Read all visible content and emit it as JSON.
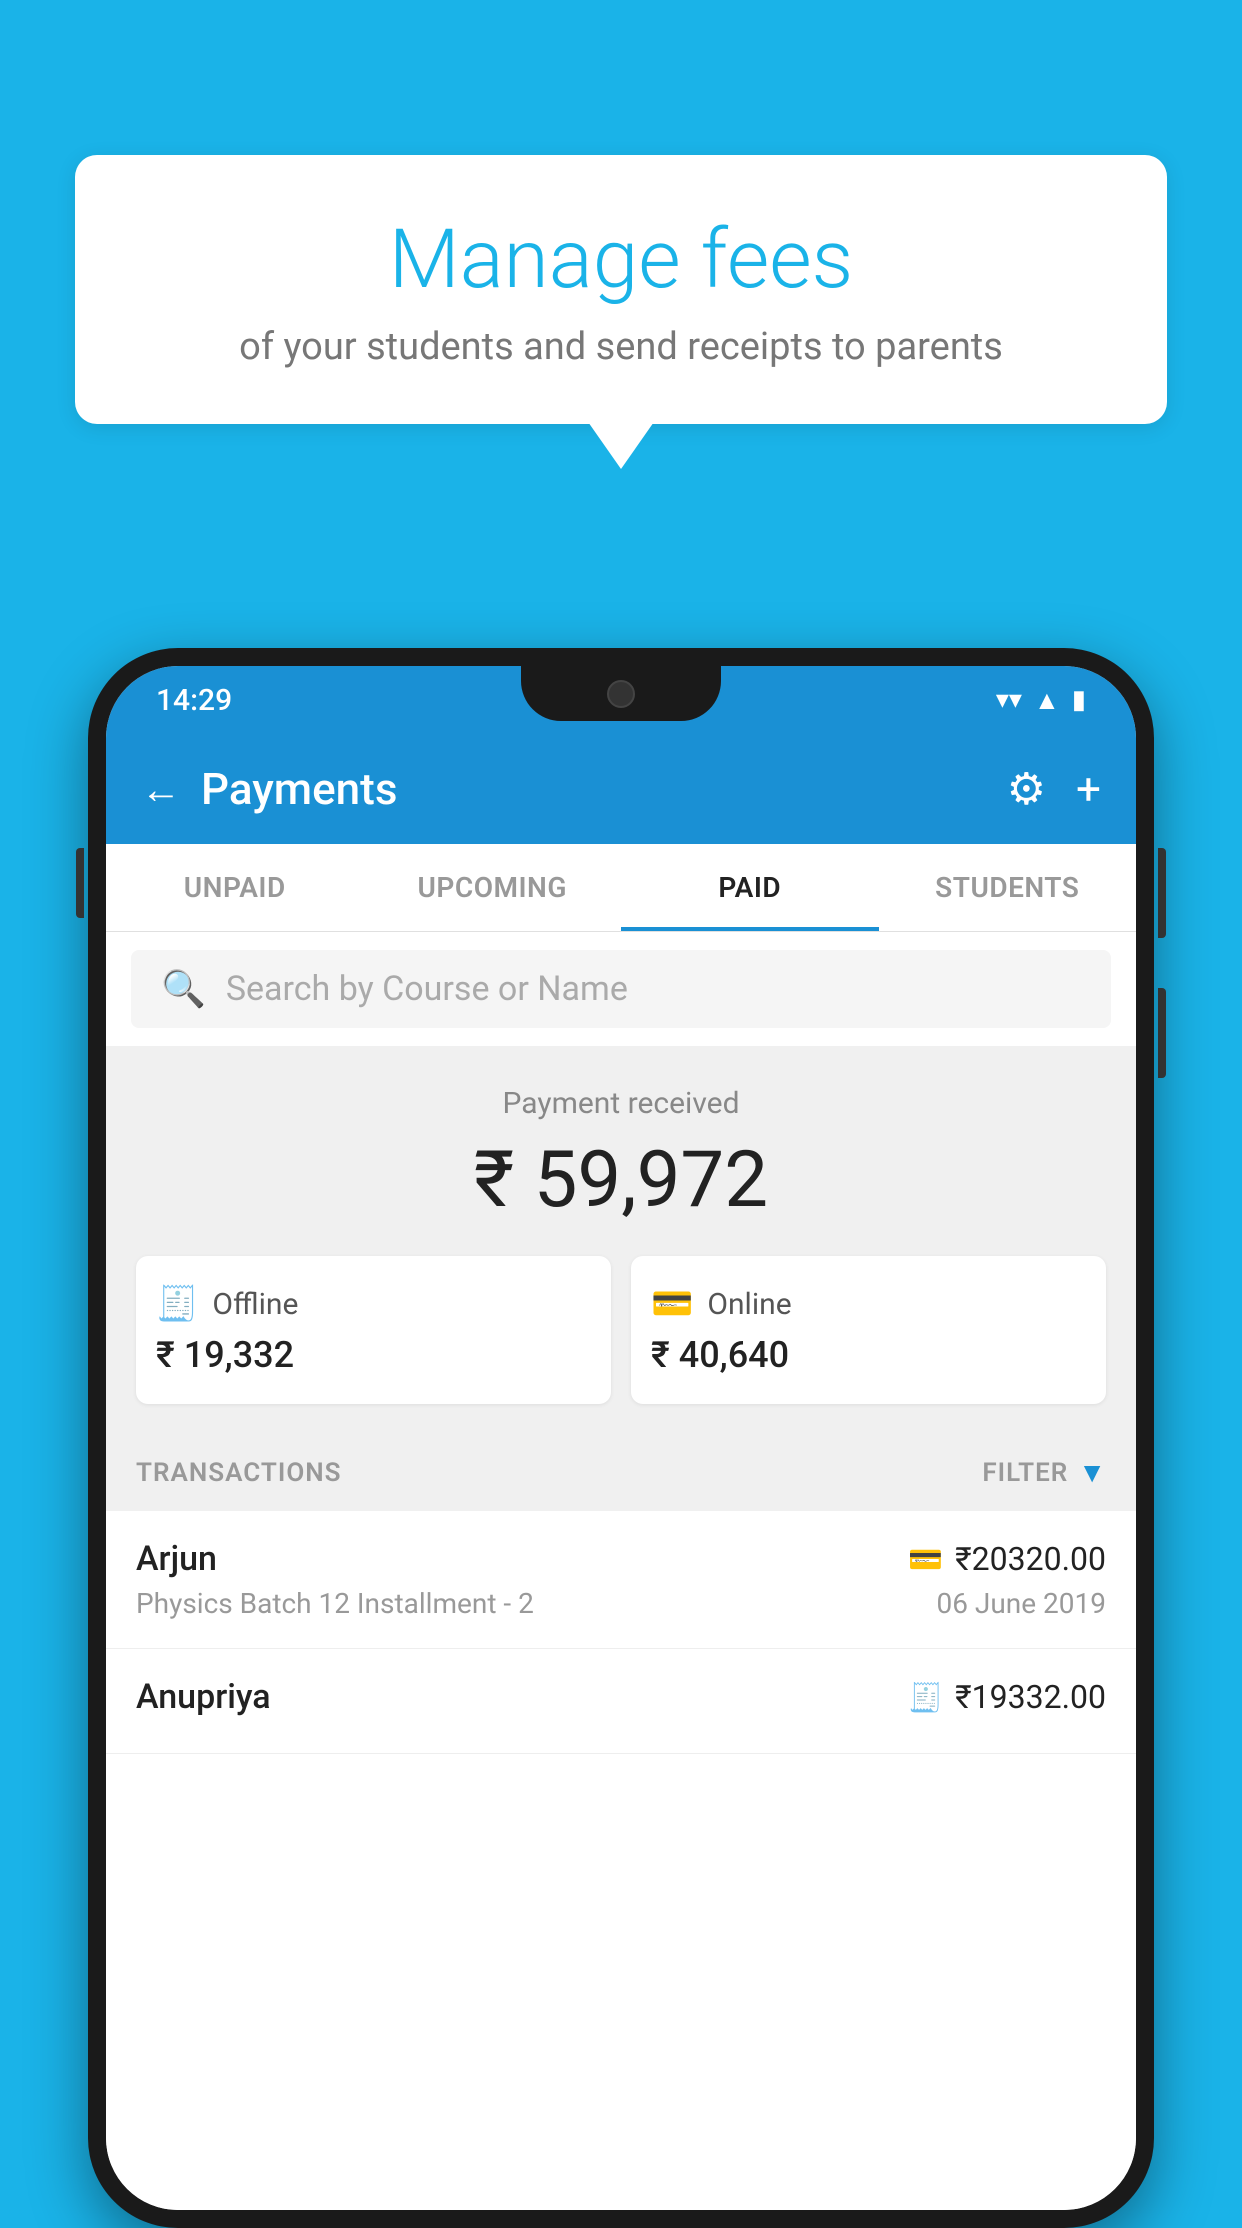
{
  "background_color": "#1ab3e8",
  "speech_bubble": {
    "title": "Manage fees",
    "subtitle": "of your students and send receipts to parents"
  },
  "phone": {
    "status_bar": {
      "time": "14:29",
      "icons": [
        "wifi",
        "signal",
        "battery"
      ]
    },
    "header": {
      "title": "Payments",
      "back_icon": "←",
      "gear_icon": "⚙",
      "plus_icon": "+"
    },
    "tabs": [
      {
        "label": "UNPAID",
        "active": false
      },
      {
        "label": "UPCOMING",
        "active": false
      },
      {
        "label": "PAID",
        "active": true
      },
      {
        "label": "STUDENTS",
        "active": false
      }
    ],
    "search": {
      "placeholder": "Search by Course or Name"
    },
    "payment_summary": {
      "label": "Payment received",
      "total": "₹ 59,972",
      "offline": {
        "type": "Offline",
        "amount": "₹ 19,332"
      },
      "online": {
        "type": "Online",
        "amount": "₹ 40,640"
      }
    },
    "transactions": {
      "header_label": "TRANSACTIONS",
      "filter_label": "FILTER",
      "items": [
        {
          "name": "Arjun",
          "course": "Physics Batch 12 Installment - 2",
          "date": "06 June 2019",
          "amount": "₹20320.00",
          "payment_type": "online"
        },
        {
          "name": "Anupriya",
          "course": "",
          "date": "",
          "amount": "₹19332.00",
          "payment_type": "offline"
        }
      ]
    }
  }
}
